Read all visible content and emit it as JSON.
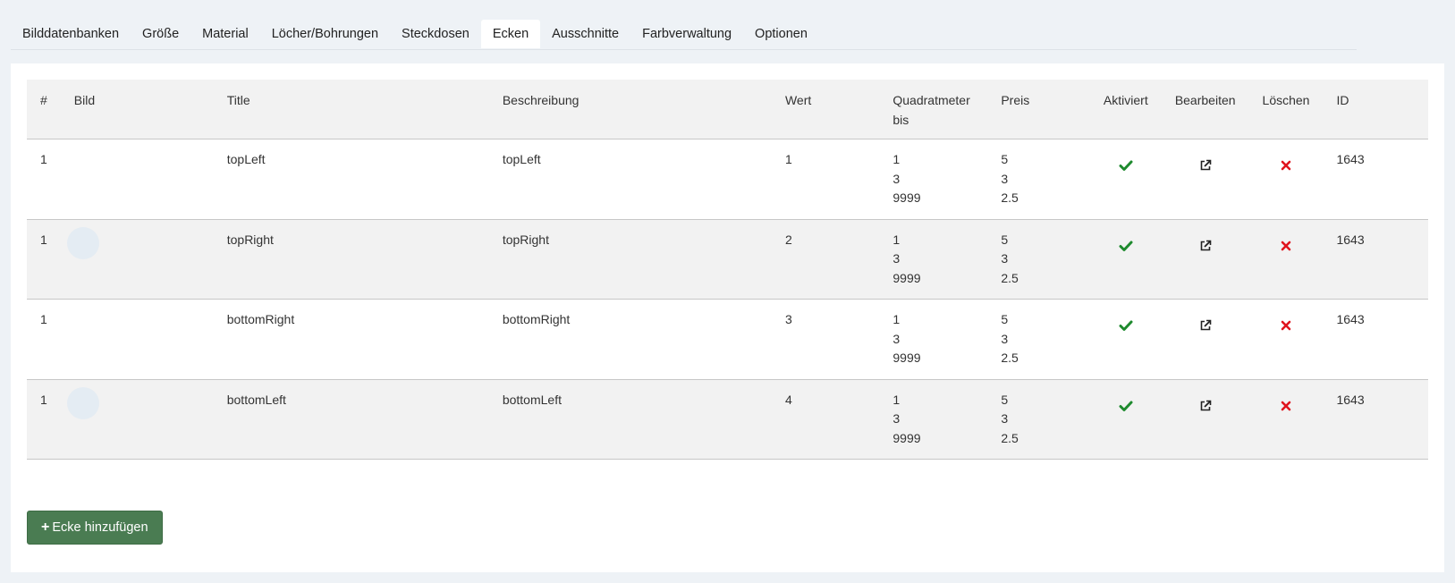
{
  "tabs": [
    {
      "label": "Bilddatenbanken"
    },
    {
      "label": "Größe"
    },
    {
      "label": "Material"
    },
    {
      "label": "Löcher/Bohrungen"
    },
    {
      "label": "Steckdosen"
    },
    {
      "label": "Ecken"
    },
    {
      "label": "Ausschnitte"
    },
    {
      "label": "Farbverwaltung"
    },
    {
      "label": "Optionen"
    }
  ],
  "active_tab": "Ecken",
  "table": {
    "headers": {
      "num": "#",
      "image": "Bild",
      "title": "Title",
      "description": "Beschreibung",
      "value": "Wert",
      "sqm_line1": "Quadratmeter",
      "sqm_line2": "bis",
      "price": "Preis",
      "active": "Aktiviert",
      "edit": "Bearbeiten",
      "delete": "Löschen",
      "id": "ID"
    },
    "rows": [
      {
        "num": "1",
        "title": "topLeft",
        "description": "topLeft",
        "value": "1",
        "sqm": [
          "1",
          "3",
          "9999"
        ],
        "price": [
          "5",
          "3",
          "2.5"
        ],
        "id": "1643",
        "has_thumb": false
      },
      {
        "num": "1",
        "title": "topRight",
        "description": "topRight",
        "value": "2",
        "sqm": [
          "1",
          "3",
          "9999"
        ],
        "price": [
          "5",
          "3",
          "2.5"
        ],
        "id": "1643",
        "has_thumb": true
      },
      {
        "num": "1",
        "title": "bottomRight",
        "description": "bottomRight",
        "value": "3",
        "sqm": [
          "1",
          "3",
          "9999"
        ],
        "price": [
          "5",
          "3",
          "2.5"
        ],
        "id": "1643",
        "has_thumb": false
      },
      {
        "num": "1",
        "title": "bottomLeft",
        "description": "bottomLeft",
        "value": "4",
        "sqm": [
          "1",
          "3",
          "9999"
        ],
        "price": [
          "5",
          "3",
          "2.5"
        ],
        "id": "1643",
        "has_thumb": true
      }
    ]
  },
  "icons": {
    "active": "check-icon",
    "edit": "external-link-icon",
    "delete": "close-icon"
  },
  "colors": {
    "check": "#1e8a2e",
    "delete": "#e0141e",
    "button": "#4a7c52",
    "background": "#eef2f6"
  },
  "add_button": {
    "label": "Ecke hinzufügen"
  }
}
